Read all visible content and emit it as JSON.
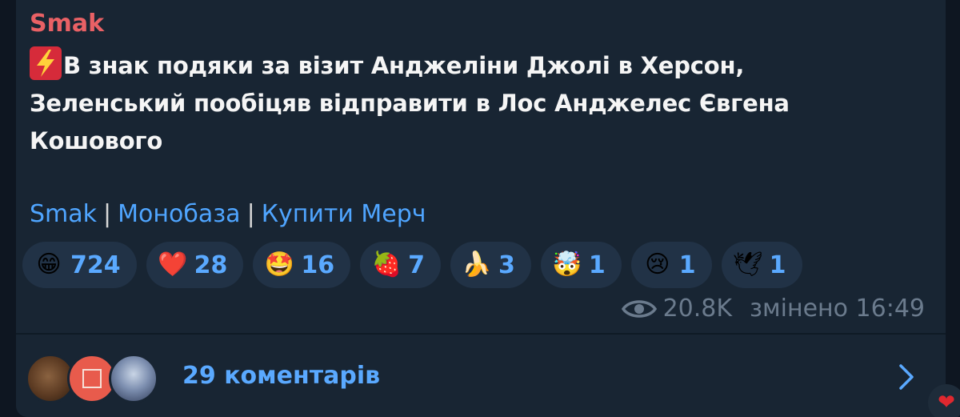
{
  "post": {
    "channel_name": "Smak",
    "text_line1": "В знак подяки за візит Анджеліни Джолі в Херсон,",
    "text_line2": "Зеленський пообіцяв відправити в Лос Анджелес Євгена",
    "text_line3": "Кошового",
    "lead_icon": "high-voltage-icon"
  },
  "links": {
    "link1": "Smak",
    "sep1": "|",
    "link2": "Монобаза",
    "sep2": "|",
    "link3": "Купити Мерч"
  },
  "reactions": [
    {
      "emoji": "😁",
      "icon": "grinning-face-icon",
      "count": "724"
    },
    {
      "emoji": "❤️",
      "icon": "red-heart-icon",
      "count": "28"
    },
    {
      "emoji": "🤩",
      "icon": "star-struck-icon",
      "count": "16"
    },
    {
      "emoji": "🍓",
      "icon": "strawberry-icon",
      "count": "7"
    },
    {
      "emoji": "🍌",
      "icon": "banana-icon",
      "count": "3"
    },
    {
      "emoji": "🤯",
      "icon": "exploding-head-icon",
      "count": "1"
    },
    {
      "emoji": "😢",
      "icon": "crying-face-icon",
      "count": "1"
    },
    {
      "emoji": "🕊",
      "icon": "dove-icon",
      "count": "1"
    }
  ],
  "meta": {
    "views": "20.8K",
    "edited_time": "змінено 16:49"
  },
  "comments": {
    "label": "29 коментарів"
  },
  "floating_reaction": {
    "emoji": "❤",
    "icon": "heart-icon"
  },
  "colors": {
    "background": "#0e1621",
    "bubble": "#182533",
    "channel_name": "#e96165",
    "link": "#4fa5ff",
    "reaction_bg": "#213246",
    "reaction_count": "#5aa9ff",
    "meta_text": "#6b7b8d"
  }
}
